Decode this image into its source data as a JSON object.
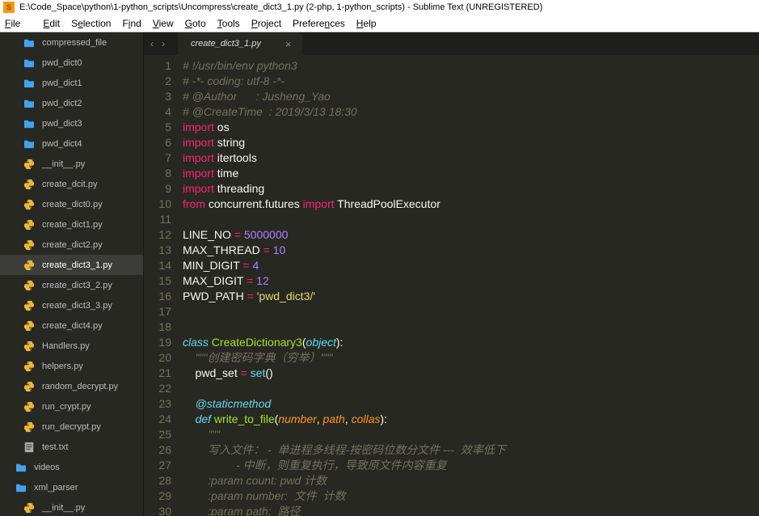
{
  "titlebar": {
    "text": "E:\\Code_Space\\python\\1-python_scripts\\Uncompress\\create_dict3_1.py (2-php, 1-python_scripts) - Sublime Text (UNREGISTERED)"
  },
  "menubar": {
    "file": "File",
    "edit": "Edit",
    "selection": "Selection",
    "find": "Find",
    "view": "View",
    "goto": "Goto",
    "tools": "Tools",
    "project": "Project",
    "preferences": "Preferences",
    "help": "Help"
  },
  "sidebar": {
    "items": [
      {
        "type": "folder",
        "label": "compressed_file"
      },
      {
        "type": "folder",
        "label": "pwd_dict0"
      },
      {
        "type": "folder",
        "label": "pwd_dict1"
      },
      {
        "type": "folder",
        "label": "pwd_dict2"
      },
      {
        "type": "folder",
        "label": "pwd_dict3"
      },
      {
        "type": "folder",
        "label": "pwd_dict4"
      },
      {
        "type": "py",
        "label": "__init__.py"
      },
      {
        "type": "py",
        "label": "create_dcit.py"
      },
      {
        "type": "py",
        "label": "create_dict0.py"
      },
      {
        "type": "py",
        "label": "create_dict1.py"
      },
      {
        "type": "py",
        "label": "create_dict2.py"
      },
      {
        "type": "py",
        "label": "create_dict3_1.py",
        "active": true
      },
      {
        "type": "py",
        "label": "create_dict3_2.py"
      },
      {
        "type": "py",
        "label": "create_dict3_3.py"
      },
      {
        "type": "py",
        "label": "create_dict4.py"
      },
      {
        "type": "py",
        "label": "Handlers.py"
      },
      {
        "type": "py",
        "label": "helpers.py"
      },
      {
        "type": "py",
        "label": "random_decrypt.py"
      },
      {
        "type": "py",
        "label": "run_crypt.py"
      },
      {
        "type": "py",
        "label": "run_decrypt.py"
      },
      {
        "type": "txt",
        "label": "test.txt"
      },
      {
        "type": "folder",
        "label": "videos",
        "indent": true
      },
      {
        "type": "folder",
        "label": "xml_parser",
        "indent": true
      },
      {
        "type": "py",
        "label": "__init__.py"
      }
    ]
  },
  "tab": {
    "name": "create_dict3_1.py",
    "close": "×"
  },
  "nav": {
    "left": "‹",
    "right": "›"
  },
  "code": {
    "line1": "# !/usr/bin/env python3",
    "line2": "# -*- coding: utf-8 -*-",
    "line3": "# @Author      : Jusheng_Yao",
    "line4": "# @CreateTime  : 2019/3/13 18:30",
    "kw_import": "import",
    "kw_from": "from",
    "kw_class": "class",
    "kw_def": "def",
    "mod_os": "os",
    "mod_string": "string",
    "mod_itertools": "itertools",
    "mod_time": "time",
    "mod_threading": "threading",
    "mod_concurrent": "concurrent.futures",
    "mod_tpe": "ThreadPoolExecutor",
    "var_lineno": "LINE_NO",
    "var_maxthread": "MAX_THREAD",
    "var_mindigit": "MIN_DIGIT",
    "var_maxdigit": "MAX_DIGIT",
    "var_pwdpath": "PWD_PATH",
    "eq": " = ",
    "num_lineno": "5000000",
    "num_maxthread": "10",
    "num_mindigit": "4",
    "num_maxdigit": "12",
    "str_pwdpath": "'pwd_dict3/'",
    "cls_name": "CreateDictionary3",
    "cls_base": "object",
    "doc_class": "\"\"\"创建密码字典（穷举）\"\"\"",
    "pwd_set": "pwd_set",
    "builtin_set": "set",
    "decorator": "@staticmethod",
    "fn_write": "write_to_file",
    "p_number": "number",
    "p_path": "path",
    "p_collas": "collas",
    "doc_open": "\"\"\"",
    "doc_l26": "写入文件： -  单进程多线程-按密码位数分文件 ---  效率低下",
    "doc_l27": "         - 中断，则重复执行，导致原文件内容重复",
    "doc_l28": ":param count: pwd 计数",
    "doc_l29": ":param number:  文件  计数",
    "doc_l30": ":param path:  路径",
    "paren_open": "(",
    "paren_close": ")",
    "colon": ":",
    "comma": ", "
  }
}
